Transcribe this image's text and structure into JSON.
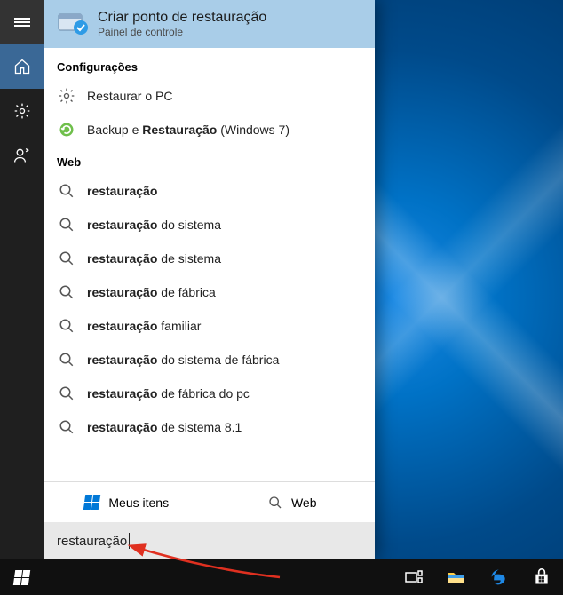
{
  "top_result": {
    "title": "Criar ponto de restauração",
    "subtitle": "Painel de controle"
  },
  "sections": {
    "settings_header": "Configurações",
    "web_header": "Web"
  },
  "settings_items": [
    {
      "icon": "gear",
      "html": "Restaurar o PC"
    },
    {
      "icon": "backup",
      "html": "Backup e <b>Restauração</b> (Windows 7)"
    }
  ],
  "web_items": [
    {
      "html": "<b>restauração</b>"
    },
    {
      "html": "<b>restauração</b> do sistema"
    },
    {
      "html": "<b>restauração</b> de sistema"
    },
    {
      "html": "<b>restauração</b> de fábrica"
    },
    {
      "html": "<b>restauração</b> familiar"
    },
    {
      "html": "<b>restauração</b> do sistema de fábrica"
    },
    {
      "html": "<b>restauração</b> de fábrica do pc"
    },
    {
      "html": "<b>restauração</b> de sistema 8.1"
    }
  ],
  "filters": {
    "my_stuff": "Meus itens",
    "web": "Web"
  },
  "search": {
    "value": "restauração"
  }
}
